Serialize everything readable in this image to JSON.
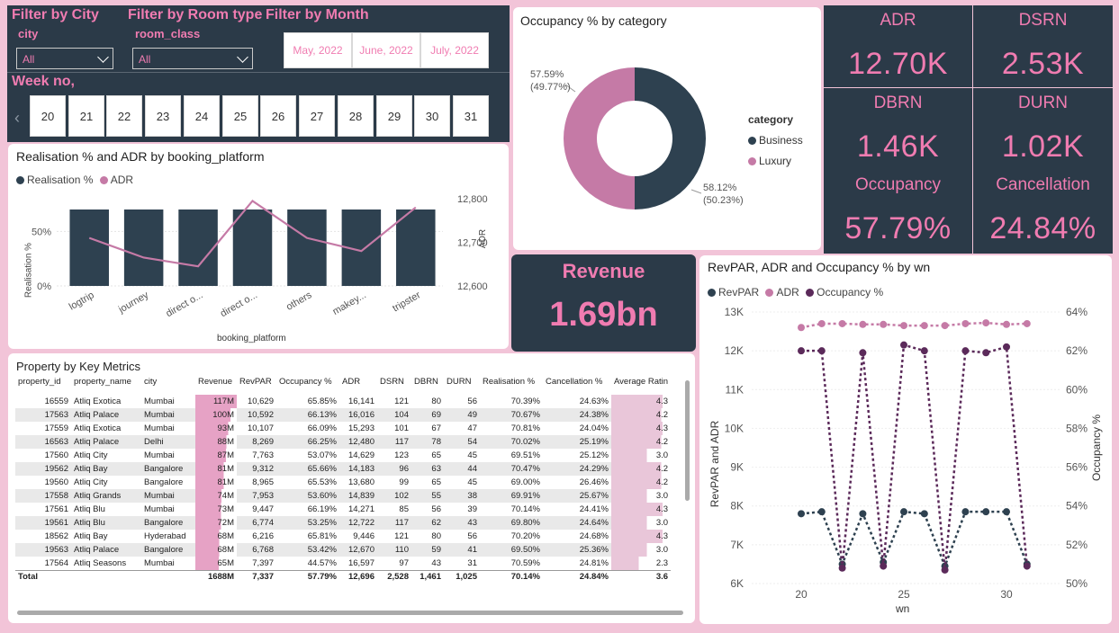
{
  "filters": {
    "city_title": "Filter by City",
    "city_label": "city",
    "city_value": "All",
    "room_title": "Filter by Room type",
    "room_label": "room_class",
    "room_value": "All",
    "month_title": "Filter by Month",
    "months": [
      "May, 2022",
      "June, 2022",
      "July, 2022"
    ],
    "week_title": "Week no,",
    "weeks": [
      "20",
      "21",
      "22",
      "23",
      "24",
      "25",
      "26",
      "27",
      "28",
      "29",
      "30",
      "31"
    ]
  },
  "donut": {
    "title": "Occupancy % by category",
    "legend_title": "category",
    "items": [
      {
        "name": "Business",
        "color": "#2e4150",
        "label": "58.12%",
        "sublabel": "(50.23%)",
        "value": 50.23
      },
      {
        "name": "Luxury",
        "color": "#c57aa6",
        "label": "57.59%",
        "sublabel": "(49.77%)",
        "value": 49.77
      }
    ]
  },
  "kpis": [
    {
      "title": "ADR",
      "value": "12.70K"
    },
    {
      "title": "DSRN",
      "value": "2.53K"
    },
    {
      "title": "DBRN",
      "value": "1.46K"
    },
    {
      "title": "DURN",
      "value": "1.02K"
    },
    {
      "title": "Occupancy",
      "value": "57.79%"
    },
    {
      "title": "Cancellation",
      "value": "24.84%"
    }
  ],
  "revenue": {
    "title": "Revenue",
    "value": "1.69bn"
  },
  "chart_data": [
    {
      "type": "bar",
      "title": "Realisation % and ADR by booking_platform",
      "categories": [
        "logtrip",
        "journey",
        "direct o...",
        "direct o...",
        "others",
        "makey...",
        "tripster"
      ],
      "series": [
        {
          "name": "Realisation %",
          "values": [
            70.1,
            70.1,
            70.1,
            70.1,
            70.1,
            70.1,
            70.1
          ],
          "color": "#2e4150"
        },
        {
          "name": "ADR",
          "values": [
            12710,
            12665,
            12645,
            12795,
            12710,
            12680,
            12780
          ],
          "color": "#c57aa6"
        }
      ],
      "xlabel": "booking_platform",
      "ylabel": "Realisation %",
      "y2label": "ADR",
      "yticks": [
        "0%",
        "50%"
      ],
      "y2ticks": [
        "12,600",
        "12,700",
        "12,800"
      ],
      "ylim": [
        0,
        80
      ],
      "y2lim": [
        12600,
        12800
      ]
    },
    {
      "type": "line",
      "title": "RevPAR, ADR and Occupancy % by wn",
      "x": [
        20,
        21,
        22,
        23,
        24,
        25,
        26,
        27,
        28,
        29,
        30,
        31
      ],
      "series": [
        {
          "name": "RevPAR",
          "values": [
            7800,
            7850,
            6500,
            7800,
            6550,
            7850,
            7800,
            6450,
            7850,
            7850,
            7850,
            6500
          ],
          "color": "#2e4150"
        },
        {
          "name": "ADR",
          "values": [
            12600,
            12700,
            12700,
            12680,
            12680,
            12650,
            12650,
            12650,
            12700,
            12720,
            12680,
            12700
          ],
          "color": "#c57aa6"
        },
        {
          "name": "Occupancy %",
          "values": [
            62.0,
            62.0,
            50.8,
            61.9,
            50.9,
            62.3,
            62.0,
            50.7,
            62.0,
            61.9,
            62.2,
            50.9
          ],
          "color": "#5b2a5a"
        }
      ],
      "xlabel": "wn",
      "ylabel": "RevPAR and ADR",
      "y2label": "Occupancy %",
      "ylim": [
        6000,
        13000
      ],
      "yticks": [
        "13K",
        "12K",
        "11K",
        "10K",
        "9K",
        "8K",
        "7K",
        "6K"
      ],
      "y2lim": [
        50,
        64
      ],
      "y2ticks": [
        "64%",
        "62%",
        "60%",
        "58%",
        "56%",
        "54%",
        "52%",
        "50%"
      ],
      "xticks": [
        "20",
        "25",
        "30"
      ]
    }
  ],
  "table": {
    "title": "Property by Key Metrics",
    "columns": [
      "property_id",
      "property_name",
      "city",
      "Revenue",
      "RevPAR",
      "Occupancy %",
      "ADR",
      "DSRN",
      "DBRN",
      "DURN",
      "Realisation %",
      "Cancellation %",
      "Average Ratin"
    ],
    "rows": [
      [
        "16559",
        "Atliq Exotica",
        "Mumbai",
        "117M",
        "10,629",
        "65.85%",
        "16,141",
        "121",
        "80",
        "56",
        "70.39%",
        "24.63%",
        "4.3"
      ],
      [
        "17563",
        "Atliq Palace",
        "Mumbai",
        "100M",
        "10,592",
        "66.13%",
        "16,016",
        "104",
        "69",
        "49",
        "70.67%",
        "24.38%",
        "4.2"
      ],
      [
        "17559",
        "Atliq Exotica",
        "Mumbai",
        "93M",
        "10,107",
        "66.09%",
        "15,293",
        "101",
        "67",
        "47",
        "70.81%",
        "24.04%",
        "4.3"
      ],
      [
        "16563",
        "Atliq Palace",
        "Delhi",
        "88M",
        "8,269",
        "66.25%",
        "12,480",
        "117",
        "78",
        "54",
        "70.02%",
        "25.19%",
        "4.2"
      ],
      [
        "17560",
        "Atliq City",
        "Mumbai",
        "87M",
        "7,763",
        "53.07%",
        "14,629",
        "123",
        "65",
        "45",
        "69.51%",
        "25.12%",
        "3.0"
      ],
      [
        "19562",
        "Atliq Bay",
        "Bangalore",
        "81M",
        "9,312",
        "65.66%",
        "14,183",
        "96",
        "63",
        "44",
        "70.47%",
        "24.29%",
        "4.2"
      ],
      [
        "19560",
        "Atliq City",
        "Bangalore",
        "81M",
        "8,965",
        "65.53%",
        "13,680",
        "99",
        "65",
        "45",
        "69.00%",
        "26.46%",
        "4.2"
      ],
      [
        "17558",
        "Atliq Grands",
        "Mumbai",
        "74M",
        "7,953",
        "53.60%",
        "14,839",
        "102",
        "55",
        "38",
        "69.91%",
        "25.67%",
        "3.0"
      ],
      [
        "17561",
        "Atliq Blu",
        "Mumbai",
        "73M",
        "9,447",
        "66.19%",
        "14,271",
        "85",
        "56",
        "39",
        "70.14%",
        "24.41%",
        "4.3"
      ],
      [
        "19561",
        "Atliq Blu",
        "Bangalore",
        "72M",
        "6,774",
        "53.25%",
        "12,722",
        "117",
        "62",
        "43",
        "69.80%",
        "24.64%",
        "3.0"
      ],
      [
        "18562",
        "Atliq Bay",
        "Hyderabad",
        "68M",
        "6,216",
        "65.81%",
        "9,446",
        "121",
        "80",
        "56",
        "70.20%",
        "24.68%",
        "4.3"
      ],
      [
        "19563",
        "Atliq Palace",
        "Bangalore",
        "68M",
        "6,768",
        "53.42%",
        "12,670",
        "110",
        "59",
        "41",
        "69.50%",
        "25.36%",
        "3.0"
      ],
      [
        "17564",
        "Atliq Seasons",
        "Mumbai",
        "65M",
        "7,397",
        "44.57%",
        "16,597",
        "97",
        "43",
        "31",
        "70.59%",
        "24.81%",
        "2.3"
      ]
    ],
    "revenue_fill": [
      1.0,
      0.85,
      0.79,
      0.75,
      0.74,
      0.69,
      0.69,
      0.63,
      0.62,
      0.62,
      0.58,
      0.58,
      0.56
    ],
    "rating_fill": [
      0.86,
      0.84,
      0.86,
      0.84,
      0.6,
      0.84,
      0.84,
      0.6,
      0.86,
      0.6,
      0.86,
      0.6,
      0.46
    ],
    "total": [
      "Total",
      "",
      "",
      "1688M",
      "7,337",
      "57.79%",
      "12,696",
      "2,528",
      "1,461",
      "1,025",
      "70.14%",
      "24.84%",
      "3.6"
    ]
  }
}
